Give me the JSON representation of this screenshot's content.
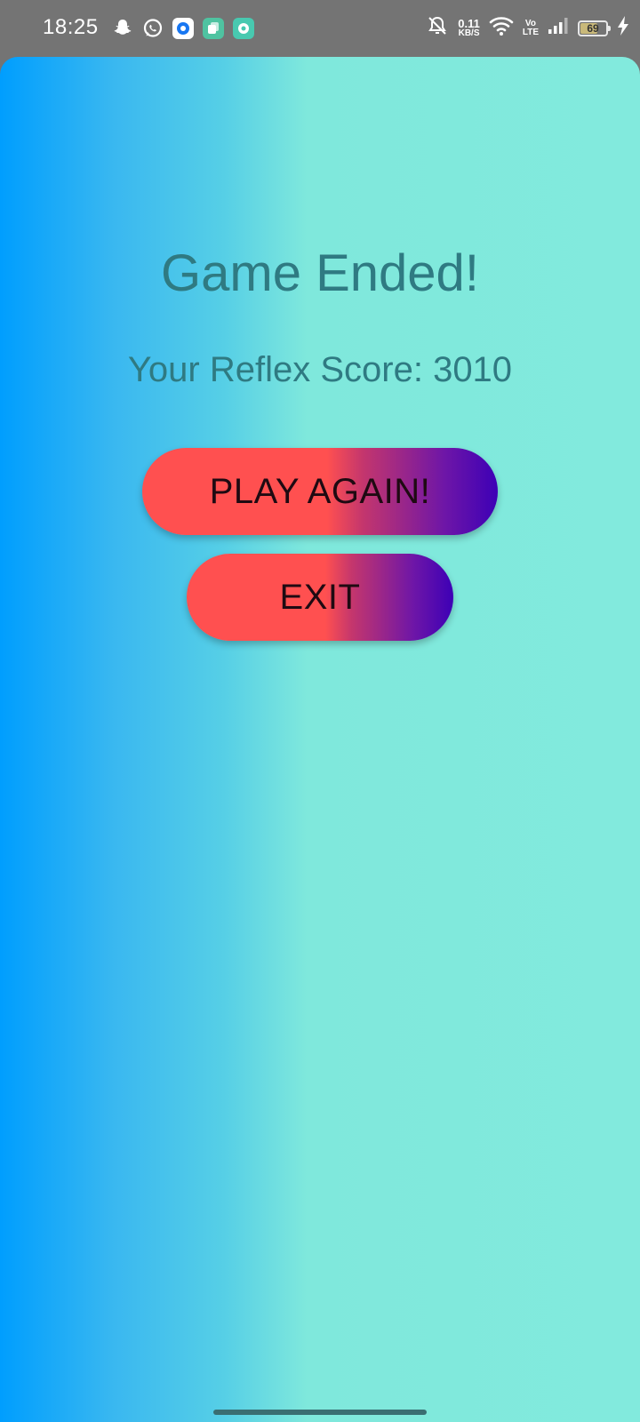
{
  "status_bar": {
    "time": "18:25",
    "net_speed_value": "0.11",
    "net_speed_unit": "KB/S",
    "volte_top": "Vo",
    "volte_bottom": "LTE",
    "battery_level": "69",
    "notification_icons": [
      "snapchat-icon",
      "whatsapp-icon",
      "app-icon",
      "app-icon",
      "app-icon"
    ],
    "system_icons": [
      "mute-bell-icon",
      "wifi-icon",
      "signal-icon",
      "battery-icon",
      "charging-icon"
    ]
  },
  "game_over": {
    "title": "Game Ended!",
    "score_text": "Your Reflex Score: 3010",
    "play_again_label": "PLAY AGAIN!",
    "exit_label": "EXIT"
  },
  "colors": {
    "background_left": "#009efe",
    "background_right": "#82eadd",
    "text": "#2f7a82",
    "button_start": "#ff5050",
    "button_end": "#3d00b6"
  }
}
